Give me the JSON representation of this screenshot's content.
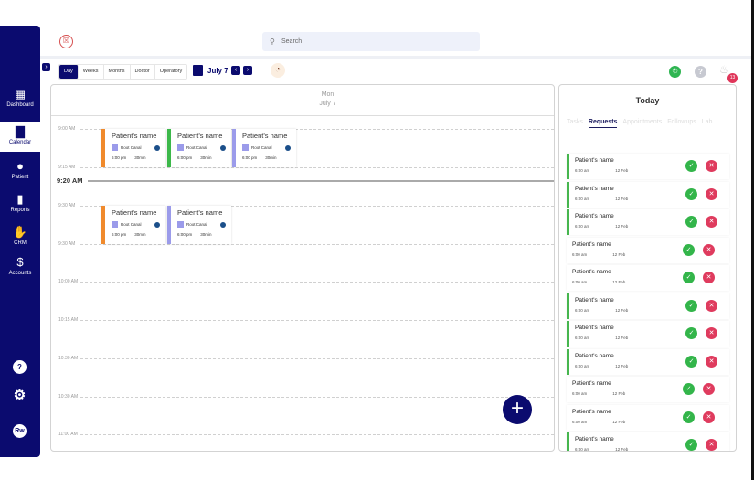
{
  "sidebar": {
    "items": [
      {
        "label": "Dashboard",
        "icon": "dashboard-icon"
      },
      {
        "label": "Calendar",
        "icon": "calendar-icon",
        "active": true
      },
      {
        "label": "Patient",
        "icon": "patient-icon"
      },
      {
        "label": "Reports",
        "icon": "reports-icon"
      },
      {
        "label": "CRM",
        "icon": "handshake-icon"
      },
      {
        "label": "Accounts",
        "icon": "accounts-icon"
      }
    ],
    "help": "?",
    "avatar": "Rw"
  },
  "header": {
    "search_placeholder": "Search"
  },
  "toolbar": {
    "views": [
      "Day",
      "Weeks",
      "Months",
      "Doctor",
      "Operatory"
    ],
    "active_view": "Day",
    "date": "July 7"
  },
  "topright": {
    "notification_count": "13"
  },
  "calendar": {
    "day": "Mon",
    "date": "July 7",
    "current_time": "9:20 AM",
    "time_labels": [
      "9:00 AM",
      "9:15 AM",
      "9:30 AM",
      "9:30 AM",
      "10:00 AM",
      "10:15 AM",
      "10:30 AM",
      "10:30 AM",
      "11:00 AM"
    ],
    "appointments": [
      {
        "name": "Patient's name",
        "procedure": "Root Canal",
        "time": "6:00 pm",
        "duration": "30min",
        "color": "#f08a2c"
      },
      {
        "name": "Patient's name",
        "procedure": "Root Canal",
        "time": "6:00 pm",
        "duration": "30min",
        "color": "#3cb84a"
      },
      {
        "name": "Patient's name",
        "procedure": "Root Canal",
        "time": "6:00 pm",
        "duration": "30min",
        "color": "#9b9bea"
      },
      {
        "name": "Patient's name",
        "procedure": "Root Canal",
        "time": "6:00 pm",
        "duration": "30min",
        "color": "#f08a2c"
      },
      {
        "name": "Patient's name",
        "procedure": "Root Canal",
        "time": "6:00 pm",
        "duration": "30min",
        "color": "#9b9bea"
      }
    ]
  },
  "panel": {
    "title": "Today",
    "tabs": [
      "Tasks",
      "Requests",
      "Appointments",
      "Followups",
      "Lab"
    ],
    "active_tab": "Requests",
    "requests": [
      {
        "name": "Patient's name",
        "time": "6:00 am",
        "date": "12 Feb",
        "flag": true
      },
      {
        "name": "Patient's name",
        "time": "6:00 am",
        "date": "12 Feb",
        "flag": true
      },
      {
        "name": "Patient's name",
        "time": "6:00 am",
        "date": "12 Feb",
        "flag": true
      },
      {
        "name": "Patient's name",
        "time": "6:00 am",
        "date": "12 Feb",
        "flag": false
      },
      {
        "name": "Patient's name",
        "time": "6:00 am",
        "date": "12 Feb",
        "flag": false
      },
      {
        "name": "Patient's name",
        "time": "6:00 am",
        "date": "12 Feb",
        "flag": true
      },
      {
        "name": "Patient's name",
        "time": "6:00 am",
        "date": "12 Feb",
        "flag": true
      },
      {
        "name": "Patient's name",
        "time": "6:00 am",
        "date": "12 Feb",
        "flag": true
      },
      {
        "name": "Patient's name",
        "time": "6:00 am",
        "date": "12 Feb",
        "flag": false
      },
      {
        "name": "Patient's name",
        "time": "6:00 am",
        "date": "12 Feb",
        "flag": false
      },
      {
        "name": "Patient's name",
        "time": "6:00 am",
        "date": "12 Feb",
        "flag": true
      }
    ]
  }
}
